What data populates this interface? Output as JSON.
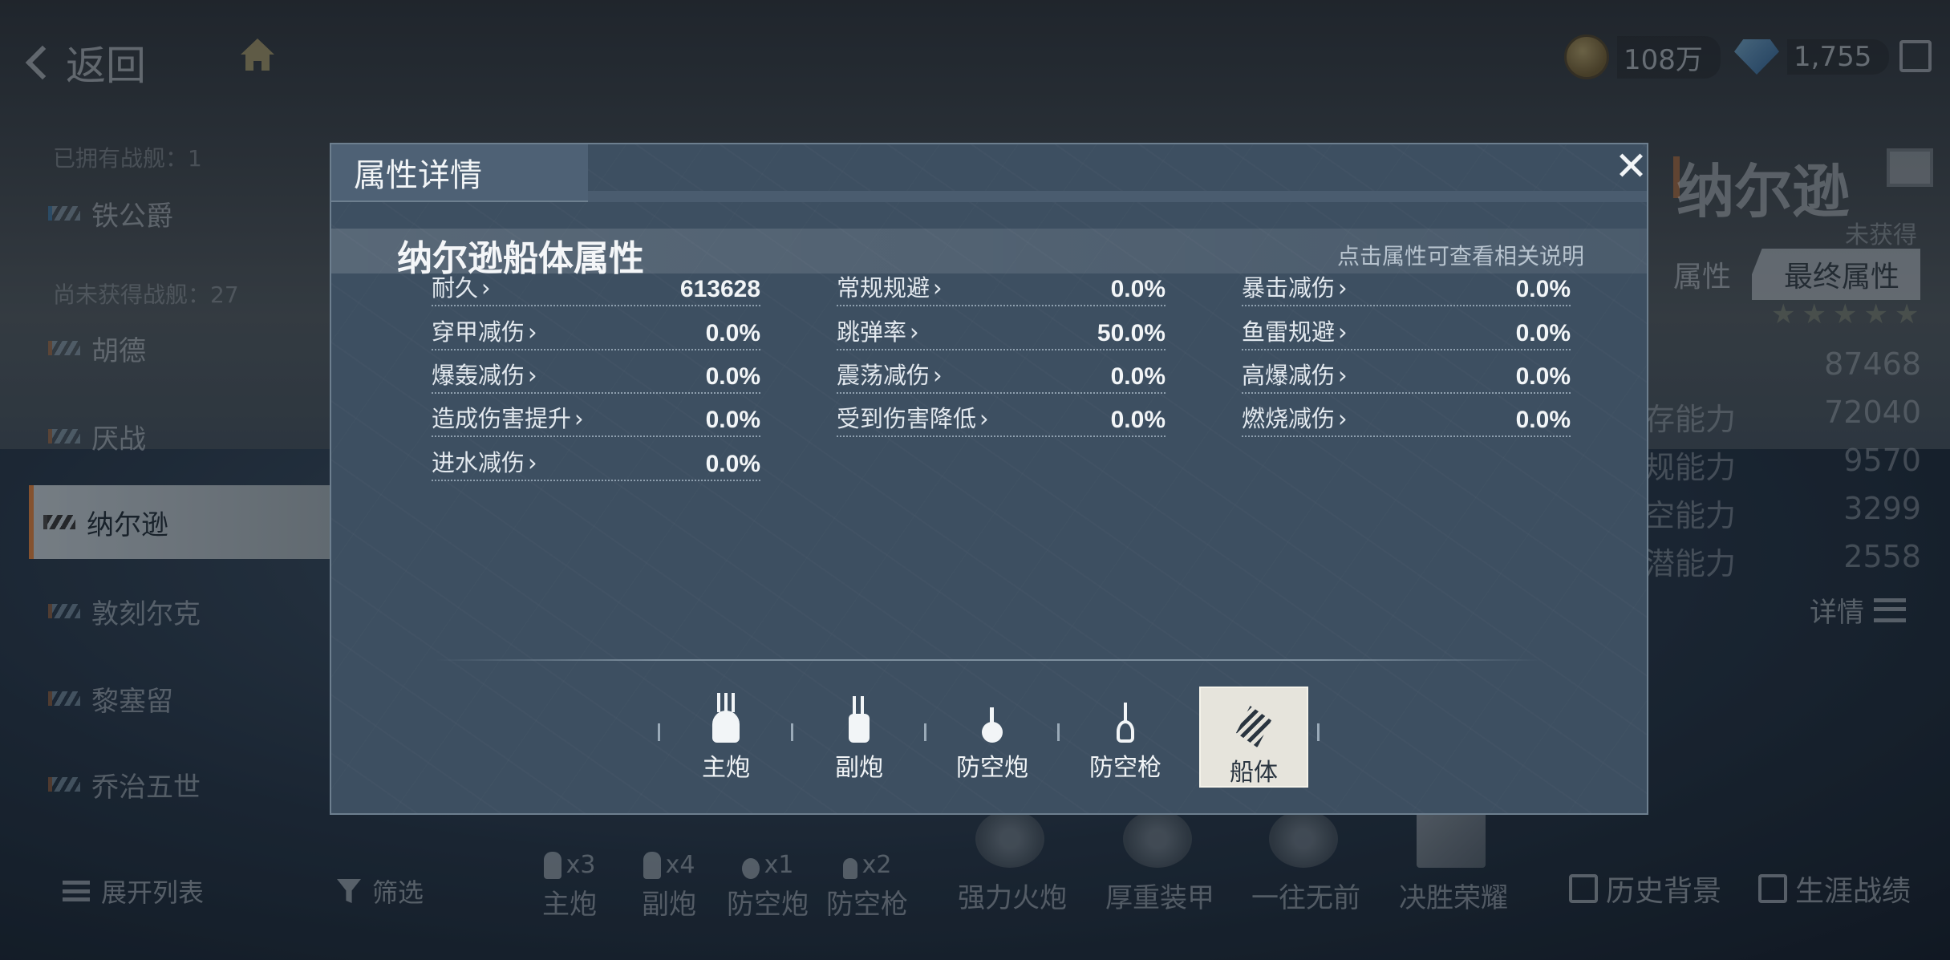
{
  "topbar": {
    "back_label": "返回",
    "coins": "108万",
    "gems": "1,755"
  },
  "fleet_list": {
    "owned_header": "已拥有战舰：1",
    "unowned_header": "尚未获得战舰：27",
    "ships": [
      {
        "name": "铁公爵"
      },
      {
        "name": "胡德"
      },
      {
        "name": "厌战"
      },
      {
        "name": "纳尔逊"
      },
      {
        "name": "敦刻尔克"
      },
      {
        "name": "黎塞留"
      },
      {
        "name": "乔治五世"
      }
    ],
    "expand_label": "展开列表",
    "filter_label": "筛选"
  },
  "weapon_strip": [
    {
      "count": "x3",
      "label": "主炮"
    },
    {
      "count": "x4",
      "label": "副炮"
    },
    {
      "count": "x1",
      "label": "防空炮"
    },
    {
      "count": "x2",
      "label": "防空枪"
    }
  ],
  "skills": [
    "强力火炮",
    "厚重装甲",
    "一往无前",
    "决胜荣耀"
  ],
  "bottom_right": {
    "history": "历史背景",
    "career": "生涯战绩"
  },
  "right_panel": {
    "ship_name": "纳尔逊",
    "status": "未获得",
    "tab_attr": "属性",
    "tab_final": "最终属性",
    "stars": "★★★★★",
    "stats": [
      {
        "label": "",
        "value": "87468"
      },
      {
        "label": "存能力",
        "value": "72040"
      },
      {
        "label": "规能力",
        "value": "9570"
      },
      {
        "label": "空能力",
        "value": "3299"
      },
      {
        "label": "潜能力",
        "value": "2558"
      }
    ],
    "detail_label": "详情"
  },
  "modal": {
    "title": "属性详情",
    "section_title": "纳尔逊船体属性",
    "hint": "点击属性可查看相关说明",
    "attributes": [
      {
        "label": "耐久",
        "value": "613628"
      },
      {
        "label": "常规规避",
        "value": "0.0%"
      },
      {
        "label": "暴击减伤",
        "value": "0.0%"
      },
      {
        "label": "穿甲减伤",
        "value": "0.0%"
      },
      {
        "label": "跳弹率",
        "value": "50.0%"
      },
      {
        "label": "鱼雷规避",
        "value": "0.0%"
      },
      {
        "label": "爆轰减伤",
        "value": "0.0%"
      },
      {
        "label": "震荡减伤",
        "value": "0.0%"
      },
      {
        "label": "高爆减伤",
        "value": "0.0%"
      },
      {
        "label": "造成伤害提升",
        "value": "0.0%"
      },
      {
        "label": "受到伤害降低",
        "value": "0.0%"
      },
      {
        "label": "燃烧减伤",
        "value": "0.0%"
      },
      {
        "label": "进水减伤",
        "value": "0.0%"
      }
    ],
    "part_tabs": [
      {
        "label": "主炮",
        "icon": "main-gun-icon"
      },
      {
        "label": "副炮",
        "icon": "secondary-gun-icon"
      },
      {
        "label": "防空炮",
        "icon": "aa-gun-icon"
      },
      {
        "label": "防空枪",
        "icon": "aa-machine-gun-icon"
      },
      {
        "label": "船体",
        "icon": "hull-icon",
        "active": true
      }
    ]
  }
}
